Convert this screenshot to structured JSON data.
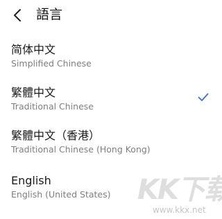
{
  "header": {
    "back_icon": "chevron-left-icon",
    "title": "語言"
  },
  "languages": [
    {
      "title": "简体中文",
      "subtitle": "Simplified Chinese",
      "selected": false
    },
    {
      "title": "繁體中文",
      "subtitle": "Traditional Chinese",
      "selected": true
    },
    {
      "title": "繁體中文（香港）",
      "subtitle": "Traditional Chinese (Hong Kong)",
      "selected": false
    },
    {
      "title": "English",
      "subtitle": "English (United States)",
      "selected": false
    }
  ],
  "check_icon": "checkmark-icon",
  "accent_color": "#3d6fd1",
  "watermark": {
    "logo_text": "KK下载",
    "url": "www.kkx.net"
  }
}
